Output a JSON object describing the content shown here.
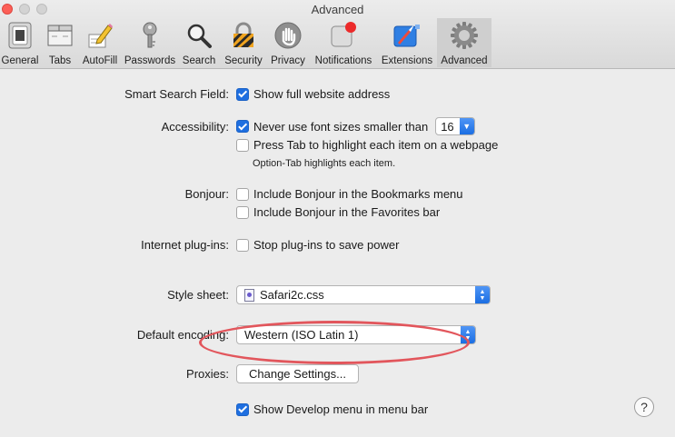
{
  "window": {
    "title": "Advanced"
  },
  "toolbar": {
    "items": [
      {
        "label": "General",
        "icon": "general-switch-icon"
      },
      {
        "label": "Tabs",
        "icon": "tabs-icon"
      },
      {
        "label": "AutoFill",
        "icon": "autofill-pencil-icon"
      },
      {
        "label": "Passwords",
        "icon": "key-icon"
      },
      {
        "label": "Search",
        "icon": "magnifier-icon"
      },
      {
        "label": "Security",
        "icon": "padlock-icon"
      },
      {
        "label": "Privacy",
        "icon": "hand-icon"
      },
      {
        "label": "Notifications",
        "icon": "notification-badge-icon"
      },
      {
        "label": "Extensions",
        "icon": "puzzle-compass-icon"
      },
      {
        "label": "Advanced",
        "icon": "gear-icon"
      }
    ],
    "selected": "Advanced"
  },
  "settings": {
    "smart_search": {
      "label": "Smart Search Field:",
      "option": "Show full website address",
      "checked": true
    },
    "accessibility": {
      "label": "Accessibility:",
      "font_option": "Never use font sizes smaller than",
      "font_checked": true,
      "font_size": "16",
      "tab_option": "Press Tab to highlight each item on a webpage",
      "tab_checked": false,
      "tab_hint": "Option-Tab highlights each item."
    },
    "bonjour": {
      "label": "Bonjour:",
      "bookmarks_option": "Include Bonjour in the Bookmarks menu",
      "favorites_option": "Include Bonjour in the Favorites bar"
    },
    "plugins": {
      "label": "Internet plug-ins:",
      "option": "Stop plug-ins to save power"
    },
    "stylesheet": {
      "label": "Style sheet:",
      "value": "Safari2c.css"
    },
    "encoding": {
      "label": "Default encoding:",
      "value": "Western (ISO Latin 1)"
    },
    "proxies": {
      "label": "Proxies:",
      "button": "Change Settings..."
    },
    "develop": {
      "option": "Show Develop menu in menu bar",
      "checked": true
    }
  },
  "help": {
    "symbol": "?"
  },
  "colors": {
    "accent": "#1f6fe0",
    "annotation": "#e2565c",
    "close": "#fc5f57"
  }
}
